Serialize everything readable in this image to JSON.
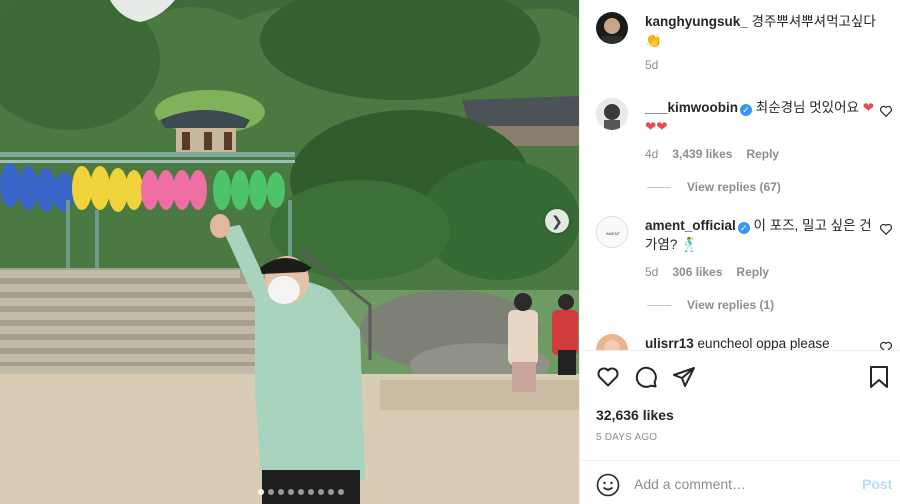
{
  "post": {
    "next_arrow_icon": "chevron-right-icon",
    "carousel": {
      "total": 9,
      "current": 1
    }
  },
  "comments": [
    {
      "username": "kanghyungsuk_",
      "verified": false,
      "text": "경주뿌셔뿌셔먹고싶다",
      "emoji": "👏",
      "time": "5d",
      "likes": "",
      "reply_label": "",
      "replies": ""
    },
    {
      "username": "___kimwoobin",
      "verified": true,
      "text": "최순경님 멋있어요",
      "emoji": "❤❤❤",
      "time": "4d",
      "likes": "3,439 likes",
      "reply_label": "Reply",
      "replies": "View replies (67)"
    },
    {
      "username": "ament_official",
      "verified": true,
      "text": "이 포즈, 밀고 싶은 건가염?",
      "emoji": "🕺",
      "time": "5d",
      "likes": "306 likes",
      "reply_label": "Reply",
      "replies": "View replies (1)"
    },
    {
      "username": "ulisrr13",
      "verified": false,
      "text": "euncheol oppa please",
      "emoji": "",
      "time": "",
      "likes": "",
      "reply_label": "",
      "replies": ""
    }
  ],
  "actions": {
    "like_icon": "heart-icon",
    "comment_icon": "comment-icon",
    "share_icon": "paper-plane-icon",
    "save_icon": "bookmark-icon",
    "likes_count": "32,636 likes",
    "time_ago": "5 DAYS AGO"
  },
  "add_comment": {
    "emoji_icon": "smiley-icon",
    "placeholder": "Add a comment…",
    "post_label": "Post"
  },
  "colors": {
    "link_blue": "#3897f0",
    "post_disabled": "#b2dffc",
    "muted_text": "#8e8e8e",
    "heart_red": "#ed4956"
  }
}
